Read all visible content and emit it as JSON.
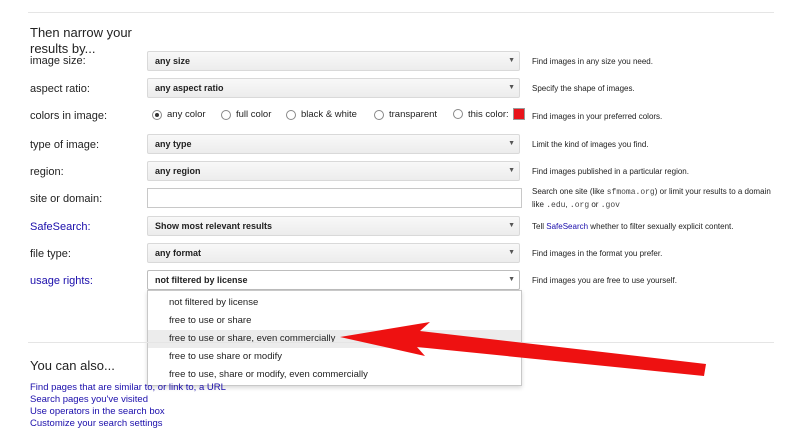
{
  "heading": "Then narrow your results by...",
  "rows": {
    "image_size": {
      "label": "image size:",
      "value": "any size",
      "desc": "Find images in any size you need."
    },
    "aspect_ratio": {
      "label": "aspect ratio:",
      "value": "any aspect ratio",
      "desc": "Specify the shape of images."
    },
    "colors": {
      "label": "colors in image:",
      "options": [
        "any color",
        "full color",
        "black & white",
        "transparent",
        "this color:"
      ],
      "selected": "any color",
      "swatch_color": "#e8141b",
      "desc": "Find images in your preferred colors."
    },
    "type_of_image": {
      "label": "type of image:",
      "value": "any type",
      "desc": "Limit the kind of images you find."
    },
    "region": {
      "label": "region:",
      "value": "any region",
      "desc": "Find images published in a particular region."
    },
    "site": {
      "label": "site or domain:",
      "value": "",
      "desc_1": "Search one site (like",
      "desc_code_1": "sfmoma.org",
      "desc_2": ") or limit your results to a domain like",
      "desc_code_2": ".edu",
      "desc_3": ",",
      "desc_code_3": ".org",
      "desc_4": "or",
      "desc_code_4": ".gov"
    },
    "safesearch": {
      "label": "SafeSearch:",
      "value": "Show most relevant results",
      "desc_1": "Tell",
      "desc_link": "SafeSearch",
      "desc_2": "whether to filter sexually explicit content."
    },
    "file_type": {
      "label": "file type:",
      "value": "any format",
      "desc": "Find images in the format you prefer."
    },
    "usage_rights": {
      "label": "usage rights:",
      "value": "not filtered by license",
      "desc": "Find images you are free to use yourself.",
      "options": [
        "not filtered by license",
        "free to use or share",
        "free to use or share, even commercially",
        "free to use share or modify",
        "free to use, share or modify, even commercially"
      ],
      "highlighted": "free to use or share, even commercially"
    }
  },
  "also": {
    "title": "You can also...",
    "links": [
      "Find pages that are similar to, or link to, a URL",
      "Search pages you've visited",
      "Use operators in the search box",
      "Customize your search settings"
    ]
  },
  "colors": {
    "link": "#1a0dab",
    "annotation_arrow": "#ee1111"
  }
}
